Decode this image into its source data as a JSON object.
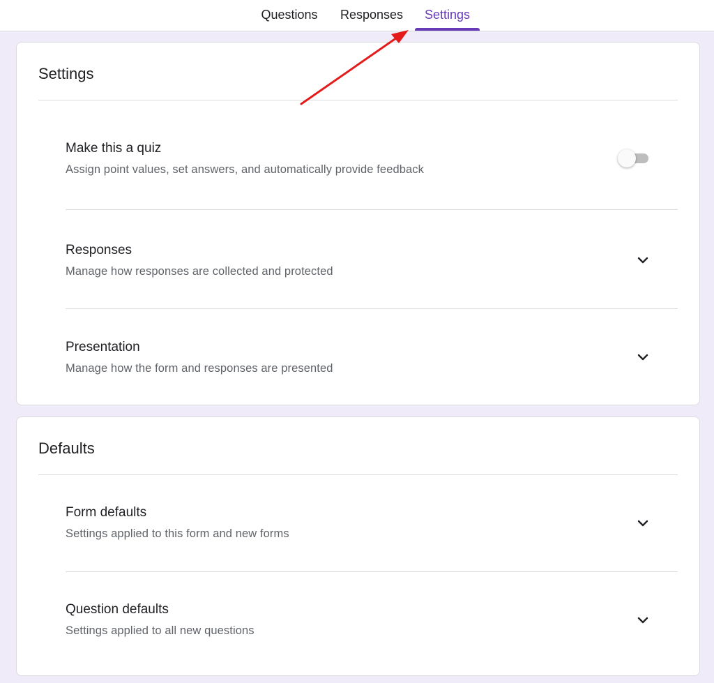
{
  "tabs": {
    "questions": "Questions",
    "responses": "Responses",
    "settings": "Settings",
    "active": "settings"
  },
  "settings_card": {
    "title": "Settings",
    "quiz": {
      "title": "Make this a quiz",
      "subtitle": "Assign point values, set answers, and automatically provide feedback",
      "enabled": false
    },
    "responses": {
      "title": "Responses",
      "subtitle": "Manage how responses are collected and protected"
    },
    "presentation": {
      "title": "Presentation",
      "subtitle": "Manage how the form and responses are presented"
    }
  },
  "defaults_card": {
    "title": "Defaults",
    "form_defaults": {
      "title": "Form defaults",
      "subtitle": "Settings applied to this form and new forms"
    },
    "question_defaults": {
      "title": "Question defaults",
      "subtitle": "Settings applied to all new questions"
    }
  },
  "colors": {
    "accent": "#673ab7",
    "page_background": "#f0ebf8",
    "annotation_arrow": "#e31b1b"
  },
  "icons": {
    "expand": "chevron-down-icon",
    "annotation": "red-arrow-annotation"
  }
}
